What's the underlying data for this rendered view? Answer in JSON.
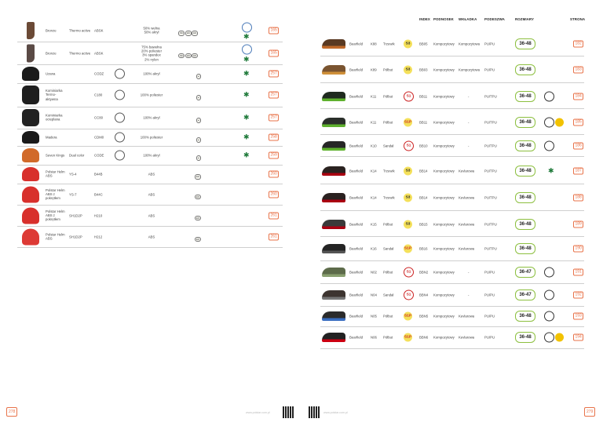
{
  "left_page": {
    "folio": "278",
    "website": "www.polstar.com.pl",
    "rows": [
      {
        "name": "Bronze",
        "variant": "Thermo active",
        "code": "ABSK",
        "material": "50% wełna\n50% akryl",
        "page": "165",
        "image": "sock-brown"
      },
      {
        "name": "Bronze",
        "variant": "Thermo active",
        "code": "ABSK",
        "material": "75% bawełna\n20% poliester\n3% spandex\n2% nylon",
        "page": "165",
        "image": "sock-grey"
      },
      {
        "name": "Uzana",
        "variant": "",
        "code": "CODZ",
        "material": "100% akryl",
        "page": "257",
        "image": "beanie"
      },
      {
        "name": "Kominiarka Termo-aktywna",
        "variant": "",
        "code": "C180",
        "material": "100% poliester",
        "page": "257",
        "image": "balaclava"
      },
      {
        "name": "Kominiarka ocieplana",
        "variant": "",
        "code": "CC80",
        "material": "100% akryl",
        "page": "257",
        "image": "balaclava-insulated"
      },
      {
        "name": "Madera",
        "variant": "",
        "code": "CDM0",
        "material": "100% poliester",
        "page": "258",
        "image": "cap-black"
      },
      {
        "name": "Seven Kings",
        "variant": "Dual color",
        "code": "CODE",
        "material": "100% akryl",
        "page": "259",
        "image": "beanie-orange"
      },
      {
        "name": "Polstar Helm ABS",
        "variant": "YS-4",
        "code": "B44B",
        "material": "ABS",
        "page": "260",
        "image": "helmet-red"
      },
      {
        "name": "Polstar Helm ABS z pokrętłem",
        "variant": "YS-7",
        "code": "B44C",
        "material": "ABS",
        "page": "260",
        "image": "helmet-red-dial"
      },
      {
        "name": "Polstar Helm ABS z pokrętłem",
        "variant": "SH1D2P",
        "code": "H210",
        "material": "ABS",
        "page": "261",
        "image": "helmet-red-visor"
      },
      {
        "name": "Polstar Helm ABS",
        "variant": "SH1D2P",
        "code": "H212",
        "material": "ABS",
        "page": "261",
        "image": "helmet-red-2"
      }
    ]
  },
  "right_page": {
    "folio": "279",
    "website": "www.polstar.com.pl",
    "headers": {
      "index": "INDEX",
      "toe": "PODNOSEK",
      "insole": "WKŁADKA",
      "sole": "PODESZWA",
      "sizes": "ROZMIARY",
      "page": "STRONA"
    },
    "rows": [
      {
        "brand": "Bearfield",
        "model": "K88",
        "type": "Trzewik",
        "class": "S3",
        "index": "BB05",
        "toe": "Kompozytowy",
        "insole": "Kompozytowa",
        "sole": "PU/PU",
        "sizes": "36-48",
        "page": "182"
      },
      {
        "brand": "Bearfield",
        "model": "K89",
        "type": "Półbut",
        "class": "S3",
        "index": "BB03",
        "toe": "Kompozytowy",
        "insole": "Kompozytowa",
        "sole": "PU/PU",
        "sizes": "36-48",
        "page": "183"
      },
      {
        "brand": "Bearfield",
        "model": "K11",
        "type": "Półbut",
        "class": "S1",
        "index": "BB11",
        "toe": "Kompozytowy",
        "insole": "-",
        "sole": "PU/TPU",
        "sizes": "36-48",
        "page": "184"
      },
      {
        "brand": "Bearfield",
        "model": "K11",
        "type": "Półbut",
        "class": "S1P",
        "index": "BB11",
        "toe": "Kompozytowy",
        "insole": "-",
        "sole": "PU/TPU",
        "sizes": "36-48",
        "page": "185"
      },
      {
        "brand": "Bearfield",
        "model": "K10",
        "type": "Sandał",
        "class": "S1",
        "index": "BB10",
        "toe": "Kompozytowy",
        "insole": "-",
        "sole": "PU/TPU",
        "sizes": "36-48",
        "page": "186"
      },
      {
        "brand": "Bearfield",
        "model": "K14",
        "type": "Trzewik",
        "class": "S3",
        "index": "BB14",
        "toe": "Kompozytowy",
        "insole": "Kevlarowa",
        "sole": "PU/TPU",
        "sizes": "36-48",
        "page": "187"
      },
      {
        "brand": "Bearfield",
        "model": "K14",
        "type": "Trzewik",
        "class": "S3",
        "index": "BB14",
        "toe": "Kompozytowy",
        "insole": "Kevlarowa",
        "sole": "PU/TPU",
        "sizes": "36-48",
        "page": "188"
      },
      {
        "brand": "Bearfield",
        "model": "K15",
        "type": "Półbut",
        "class": "S3",
        "index": "BB15",
        "toe": "Kompozytowy",
        "insole": "Kevlarowa",
        "sole": "PU/TPU",
        "sizes": "36-48",
        "page": "189"
      },
      {
        "brand": "Bearfield",
        "model": "K16",
        "type": "Sandał",
        "class": "S1P",
        "index": "BB16",
        "toe": "Kompozytowy",
        "insole": "Kevlarowa",
        "sole": "PU/TPU",
        "sizes": "36-48",
        "page": "190"
      },
      {
        "brand": "Bearfield",
        "model": "N02",
        "type": "Półbut",
        "class": "S1",
        "index": "BBN2",
        "toe": "Kompozytowy",
        "insole": "-",
        "sole": "PU/PU",
        "sizes": "36-47",
        "page": "191"
      },
      {
        "brand": "Bearfield",
        "model": "N04",
        "type": "Sandał",
        "class": "S1",
        "index": "BBN4",
        "toe": "Kompozytowy",
        "insole": "-",
        "sole": "PU/PU",
        "sizes": "36-47",
        "page": "192"
      },
      {
        "brand": "Bearfield",
        "model": "N05",
        "type": "Półbut",
        "class": "S1P",
        "index": "BBN5",
        "toe": "Kompozytowy",
        "insole": "Kevlarowa",
        "sole": "PU/PU",
        "sizes": "36-48",
        "page": "193"
      },
      {
        "brand": "Bearfield",
        "model": "N06",
        "type": "Półbut",
        "class": "S1P",
        "index": "BBN6",
        "toe": "Kompozytowy",
        "insole": "Kevlarowa",
        "sole": "PU/PU",
        "sizes": "36-48",
        "page": "194"
      }
    ]
  }
}
